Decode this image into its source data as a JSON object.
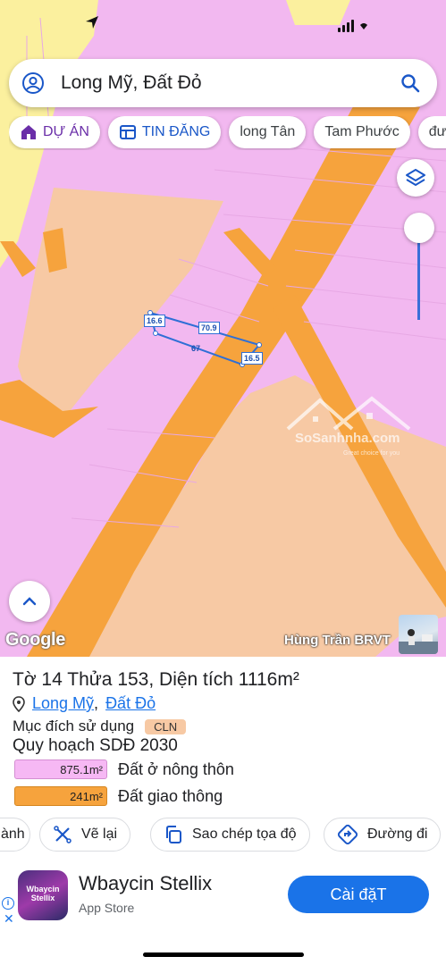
{
  "search": {
    "query": "Long Mỹ, Đất Đỏ"
  },
  "chips": [
    {
      "label": "DỰ ÁN",
      "icon": "house-icon"
    },
    {
      "label": "TIN ĐĂNG",
      "icon": "listing-icon"
    },
    {
      "label": "long Tân"
    },
    {
      "label": "Tam Phước"
    },
    {
      "label": "đườ"
    }
  ],
  "map": {
    "parcel_dimensions": [
      "16.6",
      "70.9",
      "67",
      "16.5"
    ],
    "watermark": {
      "brand": "SoSanhnha.com",
      "tagline": "Great choice for you"
    },
    "google_label": "Google",
    "user_name": "Hùng Trần BRVT",
    "colors": {
      "rural_residential": "#f2b8f0",
      "perennial_crop": "#f7c9a4",
      "transport": "#f6a33d",
      "annual_crop": "#fbf09e",
      "parcel_outline": "#2f6fd6"
    }
  },
  "panel": {
    "title": "Tờ 14 Thửa 153, Diện tích 1116m²",
    "location_ward": "Long Mỹ",
    "location_district": "Đất Đỏ",
    "purpose_label": "Mục đích sử dụng",
    "purpose_code": "CLN",
    "plan_label": "Quy hoạch SDĐ 2030",
    "legend": [
      {
        "area": "875.1m²",
        "name": "Đất ở nông thôn",
        "color": "#f6b8f4"
      },
      {
        "area": "241m²",
        "name": "Đất giao thông",
        "color": "#f6a33d"
      }
    ]
  },
  "actions": {
    "partial": "ành",
    "redraw": "Vẽ lại",
    "copy_coords": "Sao chép tọa độ",
    "directions": "Đường đi"
  },
  "ad": {
    "icon_text": "Wbaycin Stellix",
    "title": "Wbaycin Stellix",
    "store": "App Store",
    "install": "Cài đặT"
  }
}
